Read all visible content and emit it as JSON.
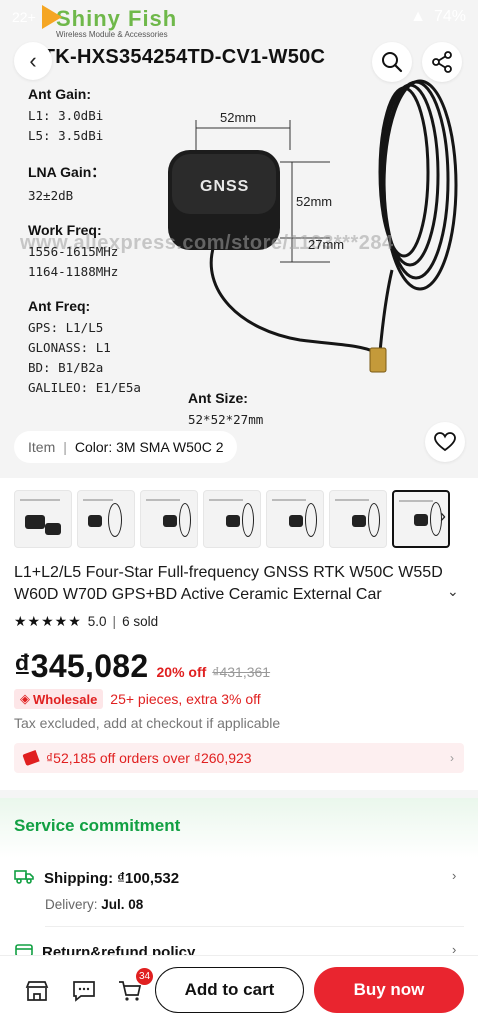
{
  "status_bar": {
    "notification_count": "22+",
    "battery": "74%"
  },
  "brand": {
    "name": "Shiny Fish",
    "tagline": "Wireless Module & Accessories"
  },
  "product_image": {
    "model_title": "RTK-HXS354254TD-CV1-W50C",
    "specs": [
      {
        "title": "Ant Gain:",
        "lines": [
          "L1: 3.0dBi",
          "L5: 3.5dBi"
        ]
      },
      {
        "title": "LNA Gain：",
        "lines": [
          "32±2dB"
        ]
      },
      {
        "title": "Work Freq:",
        "lines": [
          "1556-1615MHz",
          "1164-1188MHz"
        ]
      },
      {
        "title": "Ant Freq:",
        "lines": [
          "GPS: L1/L5",
          "GLONASS: L1",
          "BD: B1/B2a",
          "GALILEO: E1/E5a"
        ]
      }
    ],
    "ant_size": {
      "title": "Ant Size:",
      "value": "52*52*27mm"
    },
    "dimensions": {
      "width": "52mm",
      "depth": "52mm",
      "height": "27mm"
    },
    "device_label": "GNSS",
    "watermark": "www.aliexpress.com/store/1103***284",
    "item_label": "Item",
    "item_value": "Color: 3M SMA W50C 2"
  },
  "thumbnails": {
    "count": 7,
    "active_index": 6
  },
  "product": {
    "title": "L1+L2/L5 Four-Star Full-frequency GNSS RTK W50C W55D W60D W70D GPS+BD Active Ceramic External Car",
    "rating": "5.0",
    "sold": "6 sold",
    "price": "₫345,082",
    "discount": "20% off",
    "original_price": "₫431,361",
    "wholesale_badge": "Wholesale",
    "wholesale_text": "25+ pieces, extra 3% off",
    "tax_note": "Tax excluded, add at checkout if applicable",
    "coupon": "₫52,185 off orders over ₫260,923"
  },
  "service": {
    "title": "Service commitment",
    "shipping_label": "Shipping:",
    "shipping_value": "₫100,532",
    "delivery_label": "Delivery:",
    "delivery_value": "Jul. 08",
    "return_label": "Return&refund policy"
  },
  "bottom_bar": {
    "cart_count": "34",
    "add_to_cart": "Add to cart",
    "buy_now": "Buy now"
  },
  "colors": {
    "accent_red": "#e9252f",
    "service_green": "#12a043",
    "brand_green": "#6fb84a"
  }
}
